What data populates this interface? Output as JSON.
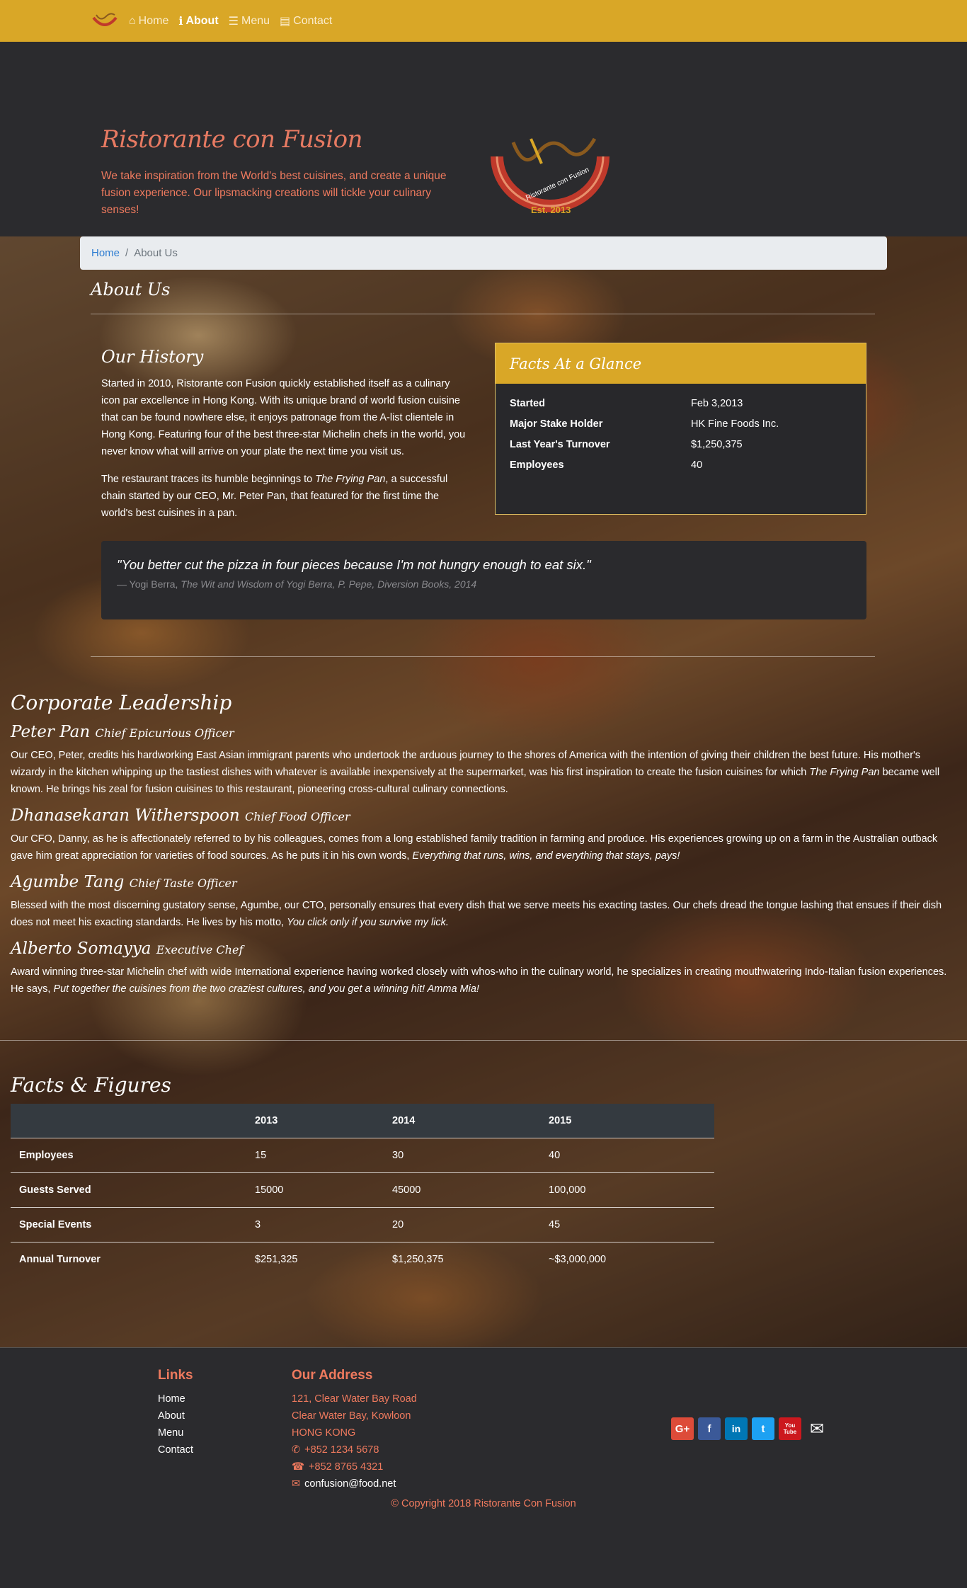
{
  "navbar": {
    "items": [
      {
        "label": "Home",
        "icon": "home-icon"
      },
      {
        "label": "About",
        "icon": "info-icon"
      },
      {
        "label": "Menu",
        "icon": "list-icon"
      },
      {
        "label": "Contact",
        "icon": "address-card-icon"
      }
    ],
    "active": "About"
  },
  "jumbotron": {
    "title": "Ristorante con Fusion",
    "text": "We take inspiration from the World's best cuisines, and create a unique fusion experience. Our lipsmacking creations will tickle your culinary senses!",
    "logo_text": "Ristorante con Fusion",
    "logo_est": "Est. 2013"
  },
  "breadcrumb": {
    "home": "Home",
    "sep": "/",
    "current": "About Us"
  },
  "page_title": "About Us",
  "history": {
    "title": "Our History",
    "p1": "Started in 2010, Ristorante con Fusion quickly established itself as a culinary icon par excellence in Hong Kong. With its unique brand of world fusion cuisine that can be found nowhere else, it enjoys patronage from the A-list clientele in Hong Kong. Featuring four of the best three-star Michelin chefs in the world, you never know what will arrive on your plate the next time you visit us.",
    "p2_a": "The restaurant traces its humble beginnings to ",
    "p2_em": "The Frying Pan",
    "p2_b": ", a successful chain started by our CEO, Mr. Peter Pan, that featured for the first time the world's best cuisines in a pan."
  },
  "facts": {
    "title": "Facts At a Glance",
    "rows": [
      {
        "label": "Started",
        "value": "Feb 3,2013"
      },
      {
        "label": "Major Stake Holder",
        "value": "HK Fine Foods Inc."
      },
      {
        "label": "Last Year's Turnover",
        "value": "$1,250,375"
      },
      {
        "label": "Employees",
        "value": "40"
      }
    ]
  },
  "quote": {
    "text": "\"You better cut the pizza in four pieces because I'm not hungry enough to eat six.\"",
    "author": "— Yogi Berra, ",
    "source": "The Wit and Wisdom of Yogi Berra, P. Pepe, Diversion Books, 2014"
  },
  "leadership": {
    "title": "Corporate Leadership",
    "leaders": [
      {
        "name": "Peter Pan",
        "role": "Chief Epicurious Officer",
        "text_a": "Our CEO, Peter, credits his hardworking East Asian immigrant parents who undertook the arduous journey to the shores of America with the intention of giving their children the best future. His mother's wizardy in the kitchen whipping up the tastiest dishes with whatever is available inexpensively at the supermarket, was his first inspiration to create the fusion cuisines for which ",
        "text_em": "The Frying Pan",
        "text_b": " became well known. He brings his zeal for fusion cuisines to this restaurant, pioneering cross-cultural culinary connections."
      },
      {
        "name": "Dhanasekaran Witherspoon",
        "role": "Chief Food Officer",
        "text_a": "Our CFO, Danny, as he is affectionately referred to by his colleagues, comes from a long established family tradition in farming and produce. His experiences growing up on a farm in the Australian outback gave him great appreciation for varieties of food sources. As he puts it in his own words, ",
        "text_em": "Everything that runs, wins, and everything that stays, pays!",
        "text_b": ""
      },
      {
        "name": "Agumbe Tang",
        "role": "Chief Taste Officer",
        "text_a": "Blessed with the most discerning gustatory sense, Agumbe, our CTO, personally ensures that every dish that we serve meets his exacting tastes. Our chefs dread the tongue lashing that ensues if their dish does not meet his exacting standards. He lives by his motto, ",
        "text_em": "You click only if you survive my lick.",
        "text_b": ""
      },
      {
        "name": "Alberto Somayya",
        "role": "Executive Chef",
        "text_a": "Award winning three-star Michelin chef with wide International experience having worked closely with whos-who in the culinary world, he specializes in creating mouthwatering Indo-Italian fusion experiences. He says, ",
        "text_em": "Put together the cuisines from the two craziest cultures, and you get a winning hit! Amma Mia!",
        "text_b": ""
      }
    ]
  },
  "figures": {
    "title": "Facts & Figures",
    "headers": [
      "",
      "2013",
      "2014",
      "2015"
    ],
    "rows": [
      [
        "Employees",
        "15",
        "30",
        "40"
      ],
      [
        "Guests Served",
        "15000",
        "45000",
        "100,000"
      ],
      [
        "Special Events",
        "3",
        "20",
        "45"
      ],
      [
        "Annual Turnover",
        "$251,325",
        "$1,250,375",
        "~$3,000,000"
      ]
    ]
  },
  "footer": {
    "links_title": "Links",
    "links": [
      "Home",
      "About",
      "Menu",
      "Contact"
    ],
    "address_title": "Our Address",
    "address_lines": [
      "121, Clear Water Bay Road",
      "Clear Water Bay, Kowloon",
      "HONG KONG"
    ],
    "phone": "+852 1234 5678",
    "fax": "+852 8765 4321",
    "email": "confusion@food.net",
    "social": [
      {
        "icon": "google-plus-icon",
        "label": "G+",
        "color": "#dd4b39"
      },
      {
        "icon": "facebook-icon",
        "label": "f",
        "color": "#3b5998"
      },
      {
        "icon": "linkedin-icon",
        "label": "in",
        "color": "#0077b5"
      },
      {
        "icon": "twitter-icon",
        "label": "t",
        "color": "#1da1f2"
      },
      {
        "icon": "youtube-icon",
        "label": "You Tube",
        "color": "#cc181e"
      },
      {
        "icon": "mail-icon",
        "label": "✉",
        "color": "transparent"
      }
    ],
    "copyright": "© Copyright 2018 Ristorante Con Fusion"
  },
  "colors": {
    "accent": "#d9a727",
    "salmon": "#ef7a5e",
    "dark": "#2b2b2e"
  }
}
